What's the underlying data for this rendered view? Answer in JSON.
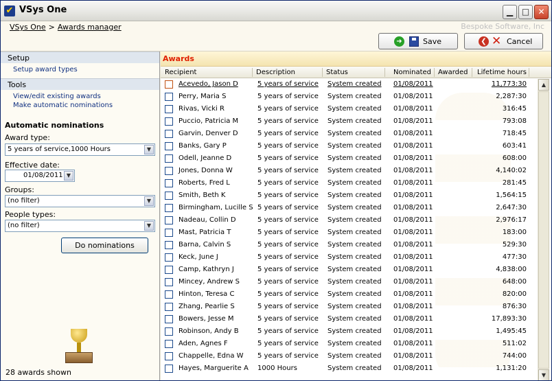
{
  "window": {
    "title": "VSys One"
  },
  "header": {
    "breadcrumb": [
      "VSys One",
      "Awards manager"
    ],
    "separator": ">",
    "company": "Bespoke Software, Inc",
    "save_label": "Save",
    "cancel_label": "Cancel"
  },
  "sidebar": {
    "setup_header": "Setup",
    "setup_items": [
      "Setup award types"
    ],
    "tools_header": "Tools",
    "tools_items": [
      "View/edit existing awards",
      "Make automatic nominations"
    ],
    "auto_title": "Automatic nominations",
    "award_type_label": "Award type:",
    "award_type_value": "5 years of service,1000 Hours",
    "effective_date_label": "Effective date:",
    "effective_date_value": "01/08/2011",
    "groups_label": "Groups:",
    "groups_value": "(no filter)",
    "people_types_label": "People types:",
    "people_types_value": "(no filter)",
    "do_nominations_label": "Do nominations",
    "status_count": "28 awards shown"
  },
  "awards": {
    "title": "Awards",
    "columns": [
      "Recipient",
      "Description",
      "Status",
      "Nominated",
      "Awarded",
      "Lifetime hours"
    ],
    "rows": [
      {
        "recipient": "Acevedo, Jason D",
        "description": "5 years of service",
        "status": "System created",
        "nominated": "01/08/2011",
        "awarded": "",
        "hours": "11,773:30"
      },
      {
        "recipient": "Perry, Maria S",
        "description": "5 years of service",
        "status": "System created",
        "nominated": "01/08/2011",
        "awarded": "",
        "hours": "2,287:30"
      },
      {
        "recipient": "Rivas, Vicki R",
        "description": "5 years of service",
        "status": "System created",
        "nominated": "01/08/2011",
        "awarded": "",
        "hours": "316:45"
      },
      {
        "recipient": "Puccio, Patricia M",
        "description": "5 years of service",
        "status": "System created",
        "nominated": "01/08/2011",
        "awarded": "",
        "hours": "793:08"
      },
      {
        "recipient": "Garvin, Denver D",
        "description": "5 years of service",
        "status": "System created",
        "nominated": "01/08/2011",
        "awarded": "",
        "hours": "718:45"
      },
      {
        "recipient": "Banks, Gary P",
        "description": "5 years of service",
        "status": "System created",
        "nominated": "01/08/2011",
        "awarded": "",
        "hours": "603:41"
      },
      {
        "recipient": "Odell, Jeanne D",
        "description": "5 years of service",
        "status": "System created",
        "nominated": "01/08/2011",
        "awarded": "",
        "hours": "608:00"
      },
      {
        "recipient": "Jones, Donna W",
        "description": "5 years of service",
        "status": "System created",
        "nominated": "01/08/2011",
        "awarded": "",
        "hours": "4,140:02"
      },
      {
        "recipient": "Roberts, Fred L",
        "description": "5 years of service",
        "status": "System created",
        "nominated": "01/08/2011",
        "awarded": "",
        "hours": "281:45"
      },
      {
        "recipient": "Smith, Beth K",
        "description": "5 years of service",
        "status": "System created",
        "nominated": "01/08/2011",
        "awarded": "",
        "hours": "1,564:15"
      },
      {
        "recipient": "Birmingham, Lucille S",
        "description": "5 years of service",
        "status": "System created",
        "nominated": "01/08/2011",
        "awarded": "",
        "hours": "2,647:30"
      },
      {
        "recipient": "Nadeau, Collin D",
        "description": "5 years of service",
        "status": "System created",
        "nominated": "01/08/2011",
        "awarded": "",
        "hours": "2,976:17"
      },
      {
        "recipient": "Mast, Patricia T",
        "description": "5 years of service",
        "status": "System created",
        "nominated": "01/08/2011",
        "awarded": "",
        "hours": "183:00"
      },
      {
        "recipient": "Barna, Calvin S",
        "description": "5 years of service",
        "status": "System created",
        "nominated": "01/08/2011",
        "awarded": "",
        "hours": "529:30"
      },
      {
        "recipient": "Keck, June J",
        "description": "5 years of service",
        "status": "System created",
        "nominated": "01/08/2011",
        "awarded": "",
        "hours": "477:30"
      },
      {
        "recipient": "Camp, Kathryn J",
        "description": "5 years of service",
        "status": "System created",
        "nominated": "01/08/2011",
        "awarded": "",
        "hours": "4,838:00"
      },
      {
        "recipient": "Mincey, Andrew S",
        "description": "5 years of service",
        "status": "System created",
        "nominated": "01/08/2011",
        "awarded": "",
        "hours": "648:00"
      },
      {
        "recipient": "Hinton, Teresa C",
        "description": "5 years of service",
        "status": "System created",
        "nominated": "01/08/2011",
        "awarded": "",
        "hours": "820:00"
      },
      {
        "recipient": "Zhang, Pearlie S",
        "description": "5 years of service",
        "status": "System created",
        "nominated": "01/08/2011",
        "awarded": "",
        "hours": "876:30"
      },
      {
        "recipient": "Bowers, Jesse M",
        "description": "5 years of service",
        "status": "System created",
        "nominated": "01/08/2011",
        "awarded": "",
        "hours": "17,893:30"
      },
      {
        "recipient": "Robinson, Andy B",
        "description": "5 years of service",
        "status": "System created",
        "nominated": "01/08/2011",
        "awarded": "",
        "hours": "1,495:45"
      },
      {
        "recipient": "Aden, Agnes F",
        "description": "5 years of service",
        "status": "System created",
        "nominated": "01/08/2011",
        "awarded": "",
        "hours": "511:02"
      },
      {
        "recipient": "Chappelle, Edna W",
        "description": "5 years of service",
        "status": "System created",
        "nominated": "01/08/2011",
        "awarded": "",
        "hours": "744:00"
      },
      {
        "recipient": "Hayes, Marguerite A",
        "description": "1000 Hours",
        "status": "System created",
        "nominated": "01/08/2011",
        "awarded": "",
        "hours": "1,131:20"
      }
    ]
  },
  "colors": {
    "accent": "#e02000",
    "link": "#103080",
    "checkbox": "#1c4a8c"
  },
  "icons": [
    "app-icon",
    "minimize-icon",
    "maximize-icon",
    "close-icon",
    "go-icon",
    "disk-icon",
    "back-icon",
    "x-icon",
    "dropdown-arrow-icon",
    "trophy-icon"
  ]
}
